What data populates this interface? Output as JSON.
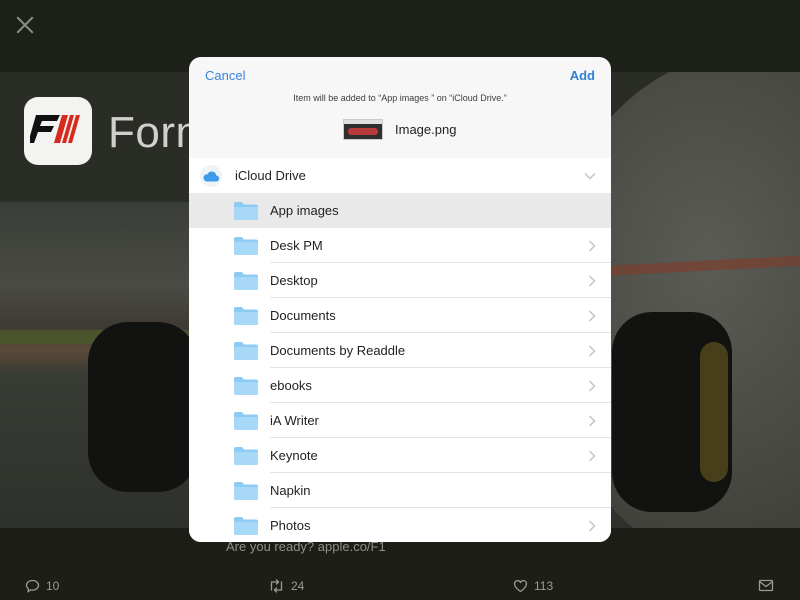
{
  "background": {
    "brand_text": "Form",
    "caption": "Are you ready? apple.co/F1",
    "actions": {
      "replies": "10",
      "retweets": "24",
      "likes": "113"
    }
  },
  "modal": {
    "cancel_label": "Cancel",
    "add_label": "Add",
    "message": "Item will be added to “App images ” on “iCloud Drive.”",
    "file_name": "Image.png",
    "root": {
      "label": "iCloud Drive"
    },
    "folders": [
      {
        "label": "App images",
        "selected": true
      },
      {
        "label": "Desk PM"
      },
      {
        "label": "Desktop"
      },
      {
        "label": "Documents"
      },
      {
        "label": "Documents by Readdle"
      },
      {
        "label": "ebooks"
      },
      {
        "label": "iA Writer"
      },
      {
        "label": "Keynote"
      },
      {
        "label": "Napkin"
      },
      {
        "label": "Photos"
      }
    ]
  },
  "colors": {
    "accent": "#2e7fd6",
    "folder": "#8dcbf5",
    "selected_row": "#e9e9e9"
  }
}
